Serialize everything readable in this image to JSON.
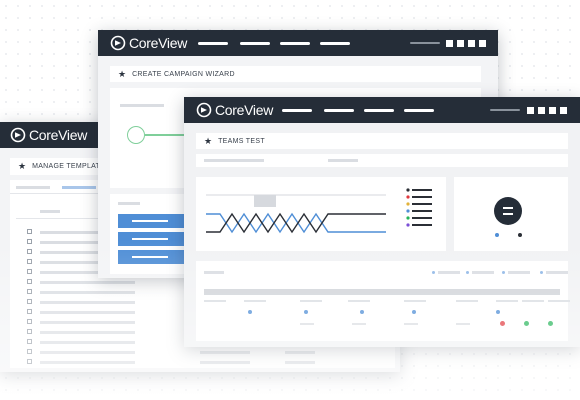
{
  "brand": {
    "name": "CoreView"
  },
  "windows": {
    "templates": {
      "title": "MANAGE TEMPLATES"
    },
    "campaign": {
      "title": "CREATE CAMPAIGN WIZARD"
    },
    "teams": {
      "title": "TEAMS TEST"
    }
  },
  "colors": {
    "topbar": "#252d38",
    "accent_blue": "#4f8ed6",
    "accent_green": "#7fcf9a",
    "status_red": "#e0393e",
    "status_green": "#27b55a"
  },
  "icons": [
    "coreview-logo-icon",
    "star-icon",
    "menu-square-icon",
    "checkbox-icon",
    "status-dot-icon"
  ]
}
